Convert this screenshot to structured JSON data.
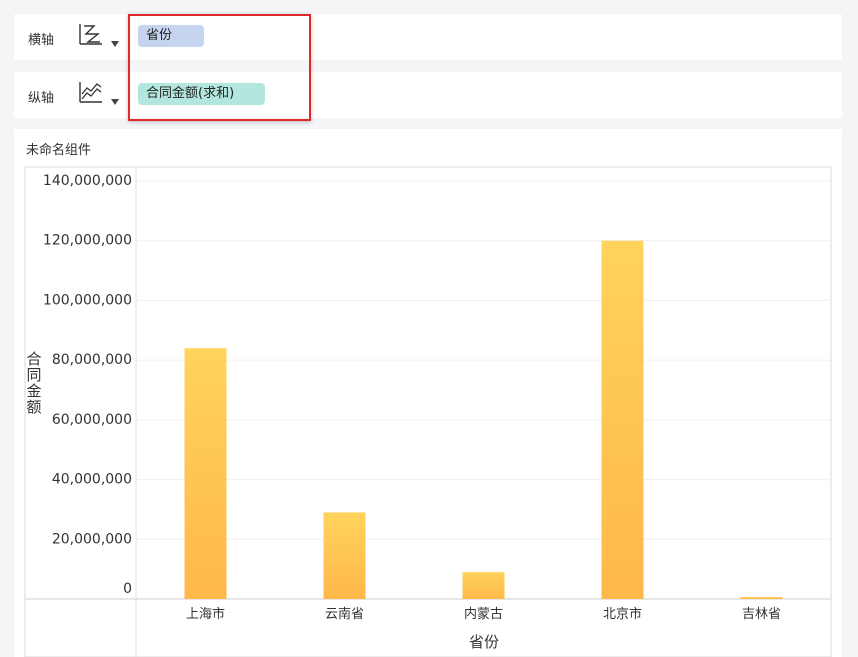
{
  "x_axis_shelf": {
    "label": "横轴",
    "chart_type_icon": "zigzag-chart-icon",
    "field": "省份"
  },
  "y_axis_shelf": {
    "label": "纵轴",
    "chart_type_icon": "line-chart-icon",
    "field": "合同金额(求和)"
  },
  "component": {
    "title": "未命名组件"
  },
  "colors": {
    "bar_top": "#ffd35c",
    "bar_bottom": "#ffb84a",
    "x_pill": "#c6d4f0",
    "y_pill": "#b3e6dd",
    "highlight": "#e02a2a"
  },
  "chart_data": {
    "type": "bar",
    "categories": [
      "上海市",
      "云南省",
      "内蒙古",
      "北京市",
      "吉林省"
    ],
    "values": [
      84000000,
      29000000,
      9000000,
      120000000,
      500000
    ],
    "xlabel": "省份",
    "ylabel": "合同金额",
    "ylim": [
      0,
      140000000
    ],
    "yticks": [
      "0",
      "20,000,000",
      "40,000,000",
      "60,000,000",
      "80,000,000",
      "100,000,000",
      "120,000,000",
      "140,000,000"
    ],
    "grid": true
  }
}
